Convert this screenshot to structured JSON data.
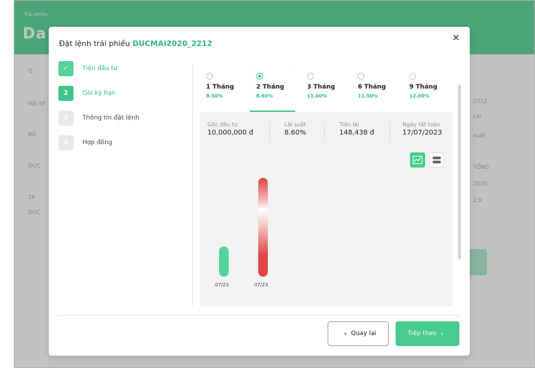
{
  "background": {
    "header_small": "Trái phiếu",
    "header_big": "Da",
    "side_left": [
      "Q",
      "MÃ TP",
      "BỘ",
      "DUC",
      "TP",
      "DUC"
    ],
    "side_right": [
      "2212",
      "Lãi",
      "xuất",
      "TỔNG",
      "2020",
      "2,9"
    ]
  },
  "modal": {
    "title_prefix": "Đặt lệnh trái phiếu ",
    "bond_code": "DUCMAI2020_2212",
    "close_icon": "×"
  },
  "steps": [
    {
      "num": "✓",
      "label": "Tiền đầu tư",
      "state": "done"
    },
    {
      "num": "2",
      "label": "Gói kỳ hạn",
      "state": "active"
    },
    {
      "num": "3",
      "label": "Thông tin đặt lệnh",
      "state": "pending"
    },
    {
      "num": "4",
      "label": "Hợp đồng",
      "state": "pending"
    }
  ],
  "terms": [
    {
      "name": "1 Tháng",
      "rate": "8.50%",
      "selected": false
    },
    {
      "name": "2 Tháng",
      "rate": "8.60%",
      "selected": true
    },
    {
      "name": "3 Tháng",
      "rate": "11.00%",
      "selected": false
    },
    {
      "name": "6 Tháng",
      "rate": "11.50%",
      "selected": false
    },
    {
      "name": "9 Tháng",
      "rate": "12.00%",
      "selected": false
    }
  ],
  "summary": {
    "principal_label": "Gốc đầu tư",
    "principal_value": "10,000,000 đ",
    "rate_label": "Lãi suất",
    "rate_value": "8.60%",
    "interest_label": "Tiền lãi",
    "interest_value": "148,438 đ",
    "maturity_label": "Ngày tất toán",
    "maturity_value": "17/07/2023"
  },
  "chart_data": {
    "type": "bar",
    "categories": [
      "07/23",
      "07/23"
    ],
    "values": [
      10000000,
      10148438
    ],
    "colors": [
      "#56d397",
      "#e04545"
    ]
  },
  "footer": {
    "back_label": "Quay lại",
    "next_label": "Tiếp theo",
    "back_chevron": "‹",
    "next_chevron": "›"
  },
  "colors": {
    "accent": "#48cc8d",
    "accent_text": "#2ebc78",
    "danger": "#e04545"
  }
}
